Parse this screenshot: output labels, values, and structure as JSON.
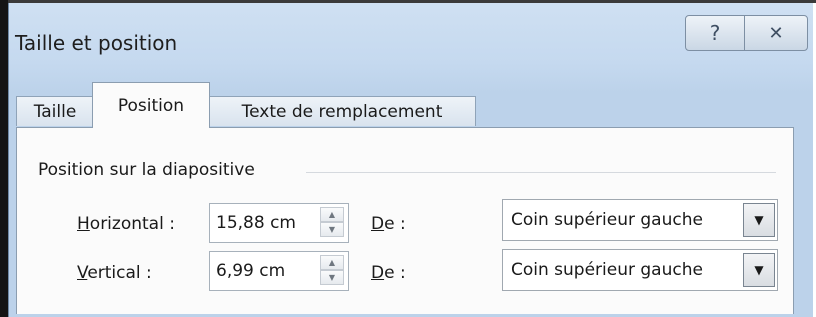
{
  "dialog": {
    "title": "Taille et position",
    "help_icon": "?",
    "close_icon": "✕"
  },
  "tabs": [
    {
      "label": "Taille",
      "active": false
    },
    {
      "label": "Position",
      "active": true
    },
    {
      "label": "Texte de remplacement",
      "active": false
    }
  ],
  "position": {
    "group_title": "Position sur la diapositive",
    "horizontal": {
      "label_underlined": "H",
      "label_rest": "orizontal :",
      "value": "15,88 cm",
      "from_label_underlined": "D",
      "from_label_rest": "e :",
      "from_value": "Coin supérieur gauche"
    },
    "vertical": {
      "label_underlined": "V",
      "label_rest": "ertical :",
      "value": "6,99 cm",
      "from_label_underlined": "D",
      "from_label_rest": "e :",
      "from_value": "Coin supérieur gauche"
    }
  },
  "icons": {
    "spin_up": "▲",
    "spin_down": "▼",
    "dropdown": "▼"
  }
}
